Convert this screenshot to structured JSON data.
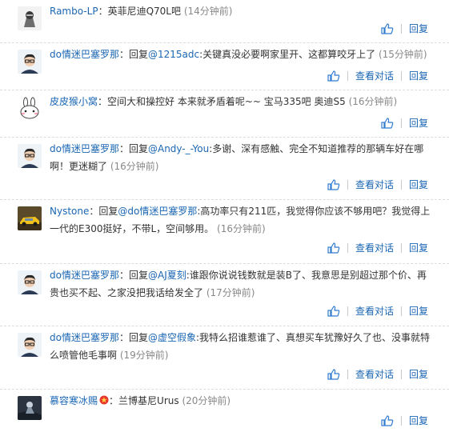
{
  "actions": {
    "view_dialog": "查看对话",
    "reply": "回复"
  },
  "comments": [
    {
      "user": "Rambo-LP",
      "prefix": "：",
      "mention": "",
      "text": "英菲尼迪Q70L吧",
      "time": "(14分钟前)",
      "has_dialog": false,
      "avatar": "racer-icon"
    },
    {
      "user": "do情迷巴塞罗那",
      "prefix": "：回复",
      "mention": "@1215adc",
      "text": ":关键真没必要啊家里开、这都算咬牙上了",
      "time": "(15分钟前)",
      "has_dialog": true,
      "avatar": "man-glasses-icon"
    },
    {
      "user": "皮皮猴小窝",
      "prefix": "：",
      "mention": "",
      "text": "空间大和操控好 本来就矛盾着呢~~ 宝马335吧 奥迪S5",
      "time": "(16分钟前)",
      "has_dialog": false,
      "avatar": "bunny-icon"
    },
    {
      "user": "do情迷巴塞罗那",
      "prefix": "：回复",
      "mention": "@Andy-_-You",
      "text": ":多谢、深有感触、完全不知道推荐的那辆车好在哪啊！更迷糊了",
      "time": "(16分钟前)",
      "has_dialog": true,
      "avatar": "man-glasses-icon"
    },
    {
      "user": "Nystone",
      "prefix": "：回复",
      "mention": "@do情迷巴塞罗那",
      "text": ":高功率只有211匹，我觉得你应该不够用吧？我觉得上一代的E300挺好，不带L，空间够用。",
      "time": "(16分钟前)",
      "has_dialog": true,
      "avatar": "car-icon"
    },
    {
      "user": "do情迷巴塞罗那",
      "prefix": "：回复",
      "mention": "@AJ夏刻",
      "text": ":谁跟你说说钱数就是装B了、我意思是别超过那个价、再贵也买不起、之家没把我话给发全了",
      "time": "(17分钟前)",
      "has_dialog": true,
      "avatar": "man-glasses-icon"
    },
    {
      "user": "do情迷巴塞罗那",
      "prefix": "：回复",
      "mention": "@虚空假象",
      "text": ":我特么招谁惹谁了、真想买车犹豫好久了也、没事就特么喷管他毛事啊",
      "time": "(19分钟前)",
      "has_dialog": true,
      "avatar": "man-glasses-icon"
    },
    {
      "user": "慕容寒冰赐",
      "prefix": "：",
      "mention": "",
      "text": "兰博基尼Urus",
      "time": "(20分钟前)",
      "has_dialog": false,
      "avatar": "rider-icon",
      "medal": "medal-icon"
    }
  ]
}
